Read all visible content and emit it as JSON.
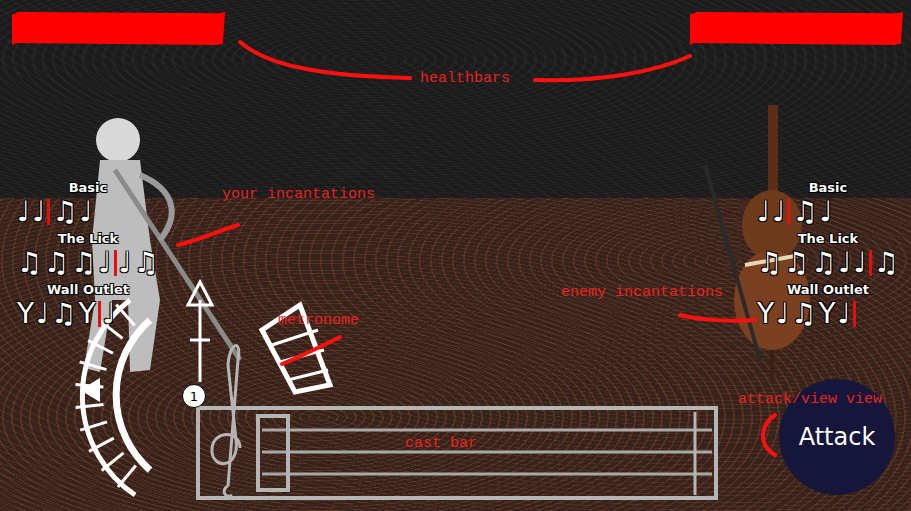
{
  "player": {
    "health": {
      "level": 1
    },
    "incantations": [
      {
        "name": "Basic",
        "notes": [
          "♩",
          "♩",
          "♫",
          "♩"
        ],
        "cursor": 2
      },
      {
        "name": "The Lick",
        "notes": [
          "♫",
          "♫",
          "♫",
          "♩",
          "♩",
          "♫"
        ],
        "cursor": 4
      },
      {
        "name": "Wall Outlet",
        "notes": [
          "Y",
          "♩",
          "♫",
          "Y",
          "♩"
        ],
        "cursor": 4
      }
    ]
  },
  "enemy": {
    "health": {
      "level": 1
    },
    "incantations": [
      {
        "name": "Basic",
        "notes": [
          "♩",
          "♩",
          "♫",
          "♩"
        ],
        "cursor": 2
      },
      {
        "name": "The Lick",
        "notes": [
          "♫",
          "♫",
          "♫",
          "♩",
          "♩",
          "♫"
        ],
        "cursor": 5
      },
      {
        "name": "Wall Outlet",
        "notes": [
          "Y",
          "♩",
          "♫",
          "Y",
          "♩"
        ],
        "cursor": 5
      }
    ]
  },
  "metronome": {
    "beat": "1"
  },
  "attack_button": {
    "label": "Attack"
  },
  "annotations": [
    {
      "text": "healthbars"
    },
    {
      "text": "your incantations"
    },
    {
      "text": "metronome"
    },
    {
      "text": "enemy incantations"
    },
    {
      "text": "attack/view view"
    },
    {
      "text": "cast bar"
    }
  ]
}
